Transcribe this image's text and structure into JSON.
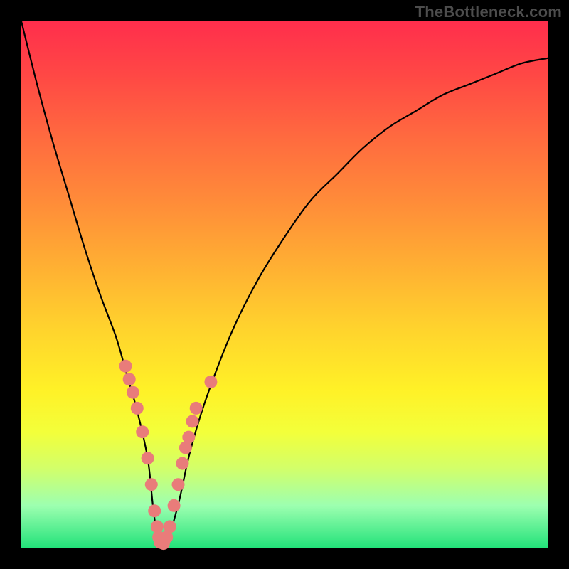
{
  "watermark": "TheBottleneck.com",
  "colors": {
    "bg_frame": "#000000",
    "gradient_top": "#ff2e4c",
    "gradient_bottom": "#23e27a",
    "curve_stroke": "#000000",
    "marker_fill": "#e97c7a",
    "marker_stroke": "#c66a68"
  },
  "chart_data": {
    "type": "line",
    "title": "",
    "xlabel": "",
    "ylabel": "",
    "xlim": [
      0,
      100
    ],
    "ylim": [
      0,
      100
    ],
    "series": [
      {
        "name": "bottleneck-curve",
        "x": [
          0,
          3,
          6,
          9,
          12,
          15,
          18,
          20,
          22,
          24,
          25,
          26,
          27,
          28,
          30,
          32,
          35,
          40,
          45,
          50,
          55,
          60,
          65,
          70,
          75,
          80,
          85,
          90,
          95,
          100
        ],
        "values": [
          100,
          88,
          77,
          67,
          57,
          48,
          40,
          33,
          26,
          17,
          8,
          1,
          0.5,
          2,
          9,
          18,
          28,
          41,
          51,
          59,
          66,
          71,
          76,
          80,
          83,
          86,
          88,
          90,
          92,
          93
        ]
      }
    ],
    "markers": {
      "name": "highlight-points",
      "x": [
        19.8,
        20.5,
        21.2,
        22.0,
        23.0,
        24.0,
        24.7,
        25.3,
        25.8,
        26.1,
        26.4,
        27.0,
        27.6,
        28.2,
        29.0,
        29.8,
        30.6,
        31.2,
        31.8,
        32.5,
        33.2,
        36.0
      ],
      "values": [
        34.5,
        32.0,
        29.5,
        26.5,
        22.0,
        17.0,
        12.0,
        7.0,
        4.0,
        2.0,
        1.0,
        0.8,
        2.0,
        4.0,
        8.0,
        12.0,
        16.0,
        19.0,
        21.0,
        24.0,
        26.5,
        31.5
      ]
    }
  }
}
